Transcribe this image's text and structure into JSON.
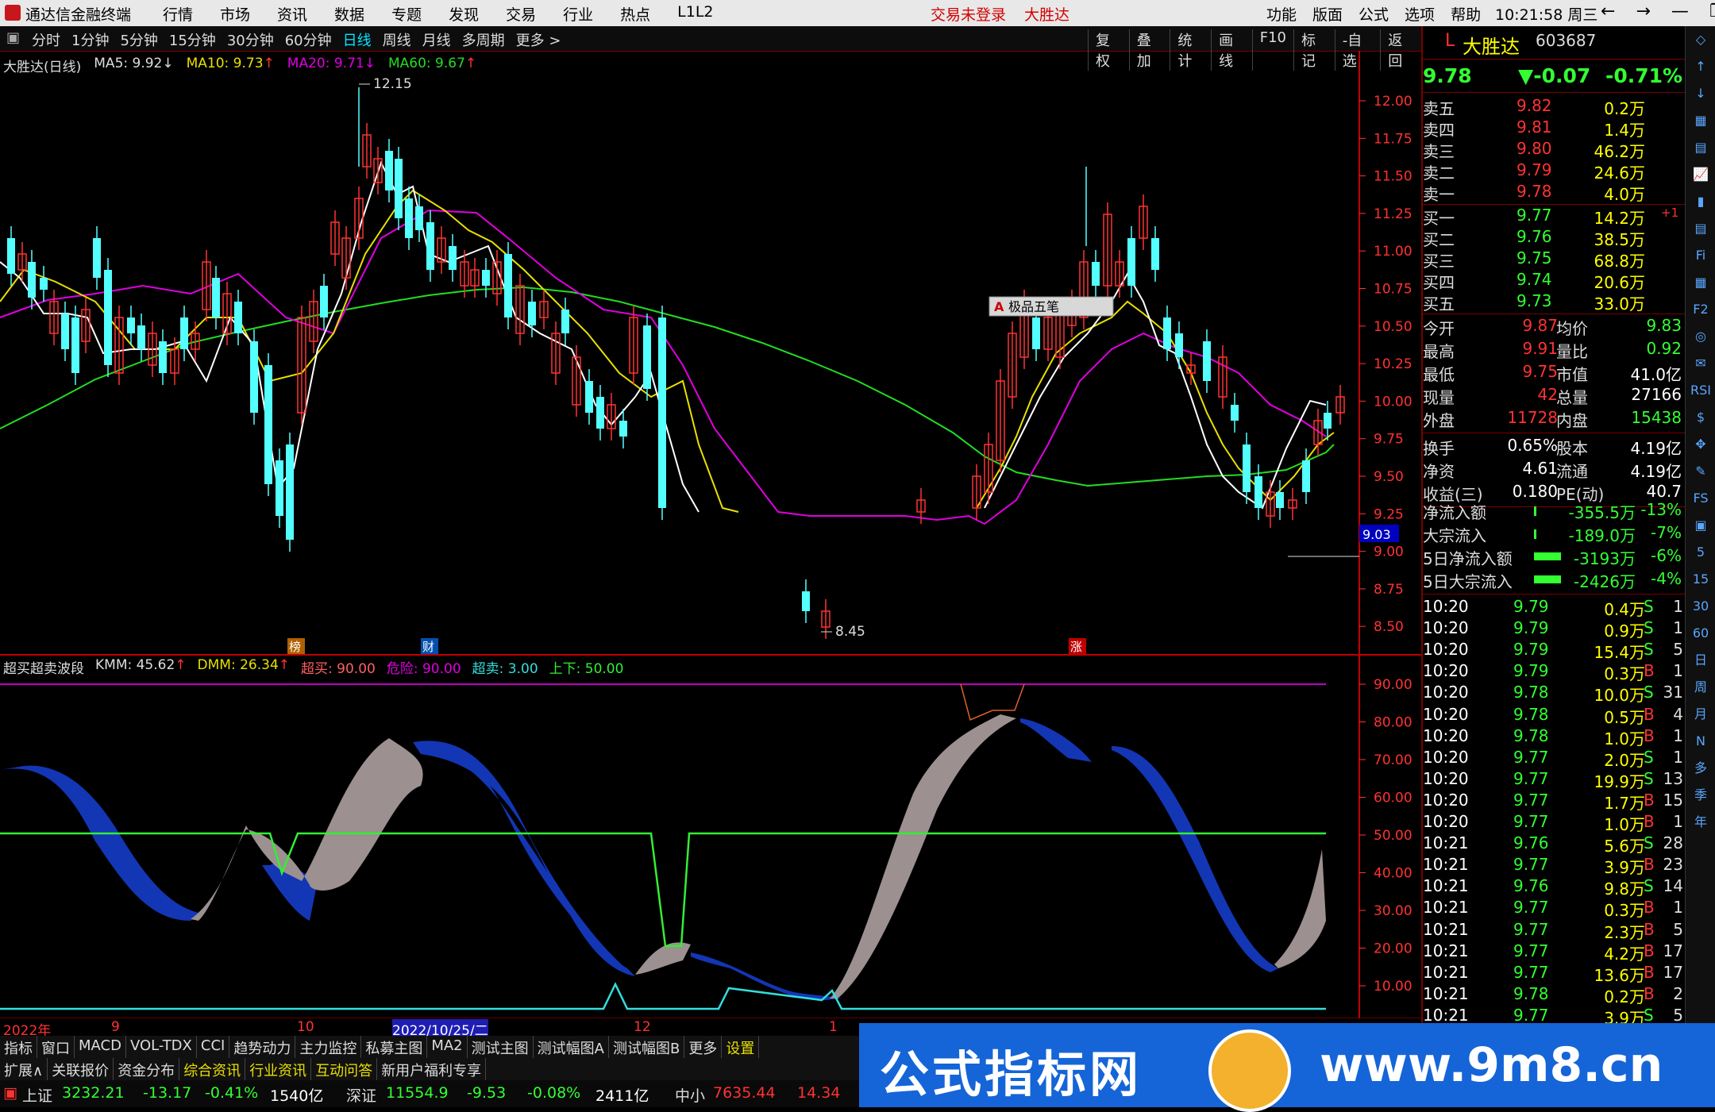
{
  "app": {
    "name": "通达信金融终端",
    "menu": [
      "行情",
      "市场",
      "资讯",
      "数据",
      "专题",
      "发现",
      "交易",
      "行业",
      "热点",
      "L1L2"
    ],
    "warning": "交易未登录",
    "warning_stock": "大胜达",
    "right_menu": [
      "功能",
      "版面",
      "公式",
      "选项",
      "帮助"
    ],
    "time": "10:21:58",
    "weekday": "周三",
    "window_controls": [
      "←",
      "→",
      "—",
      "❐",
      "✕"
    ]
  },
  "periods": [
    "分时",
    "1分钟",
    "5分钟",
    "15分钟",
    "30分钟",
    "60分钟",
    "日线",
    "周线",
    "月线",
    "多周期",
    "更多 >"
  ],
  "active_period": "日线",
  "tool_buttons": [
    "复权",
    "叠加",
    "统计",
    "画线",
    "F10",
    "标记",
    "-自选",
    "返回"
  ],
  "legend": {
    "title": "大胜达(日线)",
    "ma5": "MA5: 9.92",
    "ma10": "MA10: 9.73",
    "ma20": "MA20: 9.71",
    "ma60": "MA60: 9.67",
    "ma5_arrow": "↓",
    "ma10_arrow": "↑",
    "ma20_arrow": "↓",
    "ma60_arrow": "↑"
  },
  "colors": {
    "ma5": "#ffffff",
    "ma10": "#e8e000",
    "ma20": "#e000e0",
    "ma60": "#22dd22",
    "up": "#ff3232",
    "down": "#54ffff",
    "axis": "#ff3232"
  },
  "price_axis": [
    "12.00",
    "11.75",
    "11.50",
    "11.25",
    "11.00",
    "10.75",
    "10.50",
    "10.25",
    "10.00",
    "9.75",
    "9.50",
    "9.25",
    "9.00",
    "8.75",
    "8.50"
  ],
  "price_tag": "9.03",
  "high_label": "12.15",
  "low_label": "8.45",
  "event_tags": [
    "榜",
    "财",
    "涨"
  ],
  "toolbox_label": "极品五笔",
  "indicator": {
    "name": "超买超卖波段",
    "kmm": "KMM: 45.62",
    "dmm": "DMM: 26.34",
    "kmm_arrow": "↑",
    "dmm_arrow": "↑",
    "overbuy": "超买: 90.00",
    "danger": "危险: 90.00",
    "oversell": "超卖: 3.00",
    "updown": "上下: 50.00",
    "axis": [
      "90.00",
      "80.00",
      "70.00",
      "60.00",
      "50.00",
      "40.00",
      "30.00",
      "20.00",
      "10.00"
    ]
  },
  "date_axis": [
    "2022年",
    "9",
    "10",
    "2022/10/25/二",
    "12",
    "1"
  ],
  "tabs1": [
    "指标",
    "窗口",
    "MACD",
    "VOL-TDX",
    "CCI",
    "趋势动力",
    "主力监控",
    "私募主图",
    "MA2",
    "测试主图",
    "测试幅图A",
    "测试幅图B",
    "更多",
    "设置"
  ],
  "tabs2": [
    "扩展∧",
    "关联报价",
    "资金分布",
    "综合资讯",
    "行业资讯",
    "互动问答",
    "新用户福利专享"
  ],
  "status": {
    "sh_label": "上证",
    "sh": "3232.21",
    "sh_chg": "-13.17",
    "sh_pct": "-0.41%",
    "sh_amt": "1540亿",
    "sz_label": "深证",
    "sz": "11554.9",
    "sz_chg": "-9.53",
    "sz_pct": "-0.08%",
    "sz_amt": "2411亿",
    "zx_label": "中小",
    "zx": "7635.44",
    "zx_chg": "14.34"
  },
  "stock": {
    "prefix": "L",
    "name": "大胜达",
    "code": "603687",
    "price": "9.78",
    "change": "▼-0.07",
    "pct": "-0.71%"
  },
  "asks": [
    {
      "label": "卖五",
      "p": "9.82",
      "v": "0.2万"
    },
    {
      "label": "卖四",
      "p": "9.81",
      "v": "1.4万"
    },
    {
      "label": "卖三",
      "p": "9.80",
      "v": "46.2万"
    },
    {
      "label": "卖二",
      "p": "9.79",
      "v": "24.6万"
    },
    {
      "label": "卖一",
      "p": "9.78",
      "v": "4.0万"
    }
  ],
  "bids": [
    {
      "label": "买一",
      "p": "9.77",
      "v": "14.2万",
      "x": "+1"
    },
    {
      "label": "买二",
      "p": "9.76",
      "v": "38.5万",
      "x": ""
    },
    {
      "label": "买三",
      "p": "9.75",
      "v": "68.8万",
      "x": ""
    },
    {
      "label": "买四",
      "p": "9.74",
      "v": "20.6万",
      "x": ""
    },
    {
      "label": "买五",
      "p": "9.73",
      "v": "33.0万",
      "x": ""
    }
  ],
  "stats": [
    {
      "l1": "今开",
      "v1": "9.87",
      "l2": "均价",
      "v2": "9.83"
    },
    {
      "l1": "最高",
      "v1": "9.91",
      "l2": "量比",
      "v2": "0.92"
    },
    {
      "l1": "最低",
      "v1": "9.75",
      "l2": "市值",
      "v2": "41.0亿"
    },
    {
      "l1": "现量",
      "v1": "42",
      "l2": "总量",
      "v2": "27166"
    },
    {
      "l1": "外盘",
      "v1": "11728",
      "l2": "内盘",
      "v2": "15438"
    }
  ],
  "stats2": [
    {
      "l1": "换手",
      "v1": "0.65%",
      "l2": "股本",
      "v2": "4.19亿"
    },
    {
      "l1": "净资",
      "v1": "4.61",
      "l2": "流通",
      "v2": "4.19亿"
    },
    {
      "l1": "收益(三)",
      "v1": "0.180",
      "l2": "PE(动)",
      "v2": "40.7"
    }
  ],
  "flows": [
    {
      "l": "净流入额",
      "v": "-355.5万",
      "p": "-13%"
    },
    {
      "l": "大宗流入",
      "v": "-189.0万",
      "p": "-7%"
    },
    {
      "l": "5日净流入额",
      "v": "-3193万",
      "p": "-6%"
    },
    {
      "l": "5日大宗流入",
      "v": "-2426万",
      "p": "-4%"
    }
  ],
  "ticks": [
    [
      "10:20",
      "9.79",
      "0.4万",
      "S",
      "1"
    ],
    [
      "10:20",
      "9.79",
      "0.9万",
      "S",
      "1"
    ],
    [
      "10:20",
      "9.79",
      "15.4万",
      "S",
      "5"
    ],
    [
      "10:20",
      "9.79",
      "0.3万",
      "B",
      "1"
    ],
    [
      "10:20",
      "9.78",
      "10.0万",
      "S",
      "31"
    ],
    [
      "10:20",
      "9.78",
      "0.5万",
      "B",
      "4"
    ],
    [
      "10:20",
      "9.78",
      "1.0万",
      "B",
      "1"
    ],
    [
      "10:20",
      "9.77",
      "2.0万",
      "S",
      "1"
    ],
    [
      "10:20",
      "9.77",
      "19.9万",
      "S",
      "13"
    ],
    [
      "10:20",
      "9.77",
      "1.7万",
      "B",
      "15"
    ],
    [
      "10:20",
      "9.77",
      "1.0万",
      "B",
      "1"
    ],
    [
      "10:21",
      "9.76",
      "5.6万",
      "S",
      "28"
    ],
    [
      "10:21",
      "9.77",
      "3.9万",
      "B",
      "23"
    ],
    [
      "10:21",
      "9.76",
      "9.8万",
      "S",
      "14"
    ],
    [
      "10:21",
      "9.77",
      "0.3万",
      "B",
      "1"
    ],
    [
      "10:21",
      "9.77",
      "2.3万",
      "B",
      "5"
    ],
    [
      "10:21",
      "9.77",
      "4.2万",
      "B",
      "17"
    ],
    [
      "10:21",
      "9.77",
      "13.6万",
      "B",
      "17"
    ],
    [
      "10:21",
      "9.78",
      "0.2万",
      "B",
      "2"
    ],
    [
      "10:21",
      "9.77",
      "3.9万",
      "S",
      "5"
    ]
  ],
  "side_icons": [
    "◇",
    "↑",
    "↓",
    "▦",
    "▤",
    "📈",
    "▮",
    "▤",
    "Fi",
    "▦",
    "F2",
    "◎",
    "✉",
    "RSI",
    "$",
    "✥",
    "✎",
    "FS",
    "▣",
    "5",
    "15",
    "30",
    "60",
    "日",
    "周",
    "月",
    "N",
    "多",
    "季",
    "年"
  ],
  "banner": {
    "text1": "公式指标网",
    "text2": "www.9m8.cn"
  }
}
